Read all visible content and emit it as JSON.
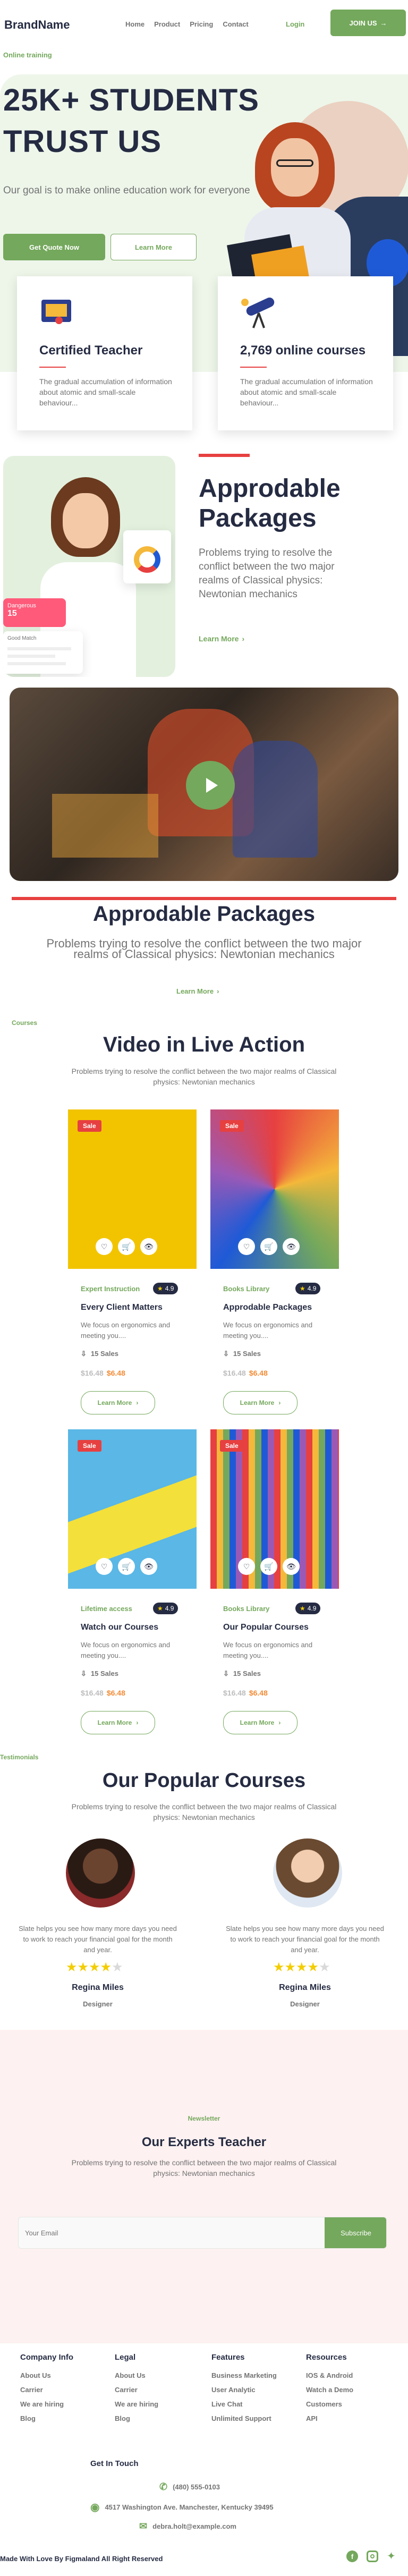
{
  "header": {
    "brand": "BrandName",
    "nav": [
      "Home",
      "Product",
      "Pricing",
      "Contact"
    ],
    "login": "Login",
    "join": "JOIN US"
  },
  "hero": {
    "tag": "Online training",
    "title": "25K+ STUDENTS TRUST US",
    "subtitle": "Our goal is to make online education work for everyone",
    "cta_primary": "Get Quote Now",
    "cta_secondary": "Learn More"
  },
  "features": [
    {
      "title": "Certified Teacher",
      "text": "The gradual accumulation of information about atomic and small-scale behaviour..."
    },
    {
      "title": "2,769 online courses",
      "text": "The gradual accumulation of information about atomic and small-scale behaviour..."
    }
  ],
  "packages": {
    "title": "Approdable Packages",
    "text": "Problems trying to resolve the conflict between the two major realms of Classical physics: Newtonian mechanics",
    "link": "Learn More",
    "mini_a": "Dangerous",
    "mini_b": "15",
    "mini_c": "Good Match",
    "mini_d": "Approdable"
  },
  "video_section": {
    "title": "Approdable Packages",
    "text": "Problems trying to resolve the conflict between the two major realms of Classical physics: Newtonian mechanics",
    "link": "Learn More"
  },
  "courses": {
    "tag": "Courses",
    "title": "Video in Live Action",
    "subtitle": "Problems trying to resolve the conflict between the two major realms of Classical physics: Newtonian mechanics",
    "items": [
      {
        "badge": "Sale",
        "category": "Expert Instruction",
        "rating": "4.9",
        "title": "Every Client Matters",
        "desc": "We focus on ergonomics and meeting you....",
        "sales": "15 Sales",
        "old_price": "$16.48",
        "new_price": "$6.48",
        "cta": "Learn More",
        "color": "#f2c400"
      },
      {
        "badge": "Sale",
        "category": "Books Library",
        "rating": "4.9",
        "title": "Approdable Packages",
        "desc": "We focus on ergonomics and meeting you....",
        "sales": "15 Sales",
        "old_price": "$16.48",
        "new_price": "$6.48",
        "cta": "Learn More",
        "color": "#e9a26a"
      },
      {
        "badge": "Sale",
        "category": "Lifetime access",
        "rating": "4.9",
        "title": "Watch our Courses",
        "desc": "We focus on ergonomics and meeting you....",
        "sales": "15 Sales",
        "old_price": "$16.48",
        "new_price": "$6.48",
        "cta": "Learn More",
        "color": "#5ab7e6"
      },
      {
        "badge": "Sale",
        "category": "Books Library",
        "rating": "4.9",
        "title": "Our Popular Courses",
        "desc": "We focus on ergonomics and meeting you....",
        "sales": "15 Sales",
        "old_price": "$16.48",
        "new_price": "$6.48",
        "cta": "Learn More",
        "color": "#2a3d8f"
      }
    ]
  },
  "testimonials": {
    "tag": "Testimonials",
    "title": "Our Popular Courses",
    "subtitle": "Problems trying to resolve the conflict between the two major realms of Classical physics: Newtonian mechanics",
    "items": [
      {
        "quote": "Slate helps you see how many more days you need to work to reach your financial goal for the month and year.",
        "name": "Regina Miles",
        "role": "Designer",
        "rating": 4
      },
      {
        "quote": "Slate helps you see how many more days you need to work to reach your financial goal for the month and year.",
        "name": "Regina Miles",
        "role": "Designer",
        "rating": 4
      }
    ]
  },
  "newsletter": {
    "tag": "Newsletter",
    "title": "Our Experts Teacher",
    "text": "Problems trying to resolve the conflict between the two major realms of Classical physics: Newtonian mechanics",
    "placeholder": "Your Email",
    "button": "Subscribe"
  },
  "footer": {
    "columns": [
      {
        "title": "Company Info",
        "links": [
          "About Us",
          "Carrier",
          "We are hiring",
          "Blog"
        ]
      },
      {
        "title": "Legal",
        "links": [
          "About Us",
          "Carrier",
          "We are hiring",
          "Blog"
        ]
      },
      {
        "title": "Features",
        "links": [
          "Business Marketing",
          "User Analytic",
          "Live Chat",
          "Unlimited Support"
        ]
      },
      {
        "title": "Resources",
        "links": [
          "IOS & Android",
          "Watch a Demo",
          "Customers",
          "API"
        ]
      }
    ],
    "touch_title": "Get In Touch",
    "phone": "(480) 555-0103",
    "address": "4517 Washington Ave. Manchester, Kentucky 39495",
    "email": "debra.holt@example.com",
    "copyright": "Made With Love By Figmaland All Right Reserved"
  },
  "colors": {
    "accent": "#74a85c",
    "dark": "#252b42",
    "muted": "#737373",
    "sale": "#e74040",
    "newsletter_bg": "#fdf1f1"
  }
}
